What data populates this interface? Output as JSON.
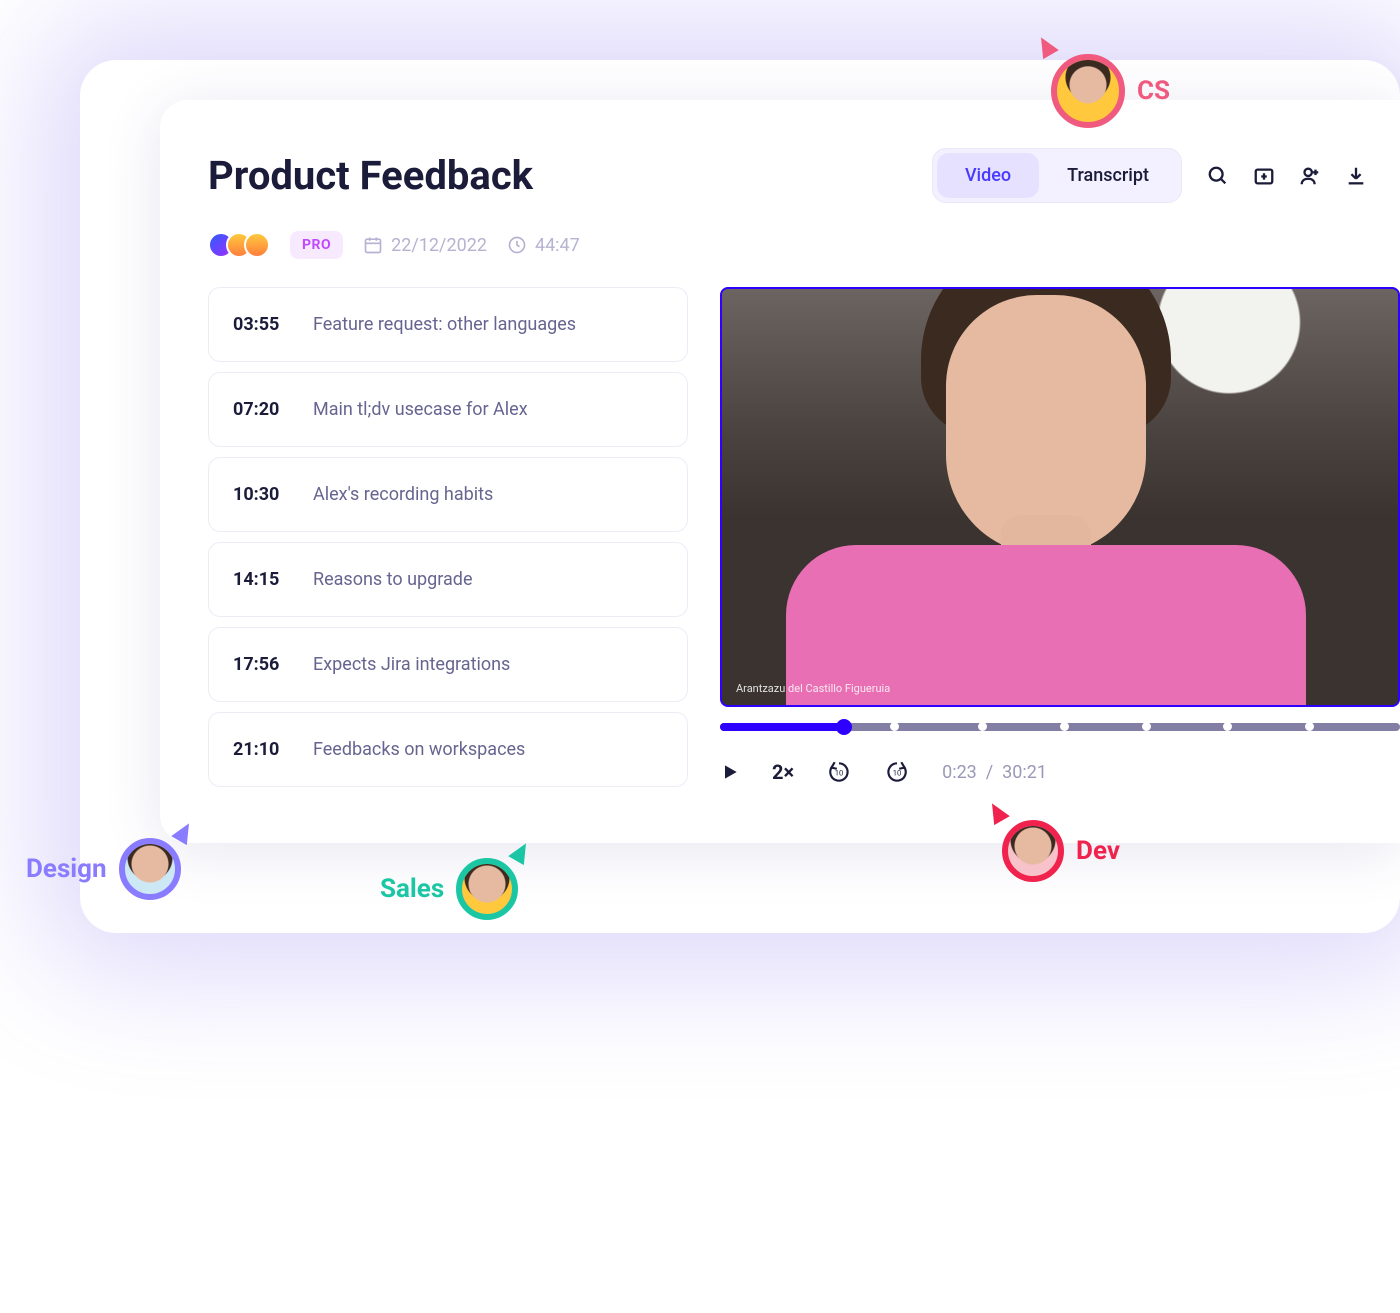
{
  "header": {
    "title": "Product Feedback",
    "tabs": {
      "video": "Video",
      "transcript": "Transcript"
    },
    "pro_badge": "PRO",
    "date": "22/12/2022",
    "duration": "44:47"
  },
  "highlights": [
    {
      "time": "03:55",
      "text": "Feature request: other languages"
    },
    {
      "time": "07:20",
      "text": "Main tl;dv usecase for Alex"
    },
    {
      "time": "10:30",
      "text": "Alex's recording habits"
    },
    {
      "time": "14:15",
      "text": "Reasons to upgrade"
    },
    {
      "time": "17:56",
      "text": "Expects Jira integrations"
    },
    {
      "time": "21:10",
      "text": "Feedbacks on workspaces"
    }
  ],
  "video": {
    "caption": "Arantzazu del Castillo Figueruia",
    "speed": "2×",
    "current": "0:23",
    "sep": "/",
    "total": "30:21"
  },
  "cursors": {
    "cs": "CS",
    "dev": "Dev",
    "design": "Design",
    "sales": "Sales"
  }
}
